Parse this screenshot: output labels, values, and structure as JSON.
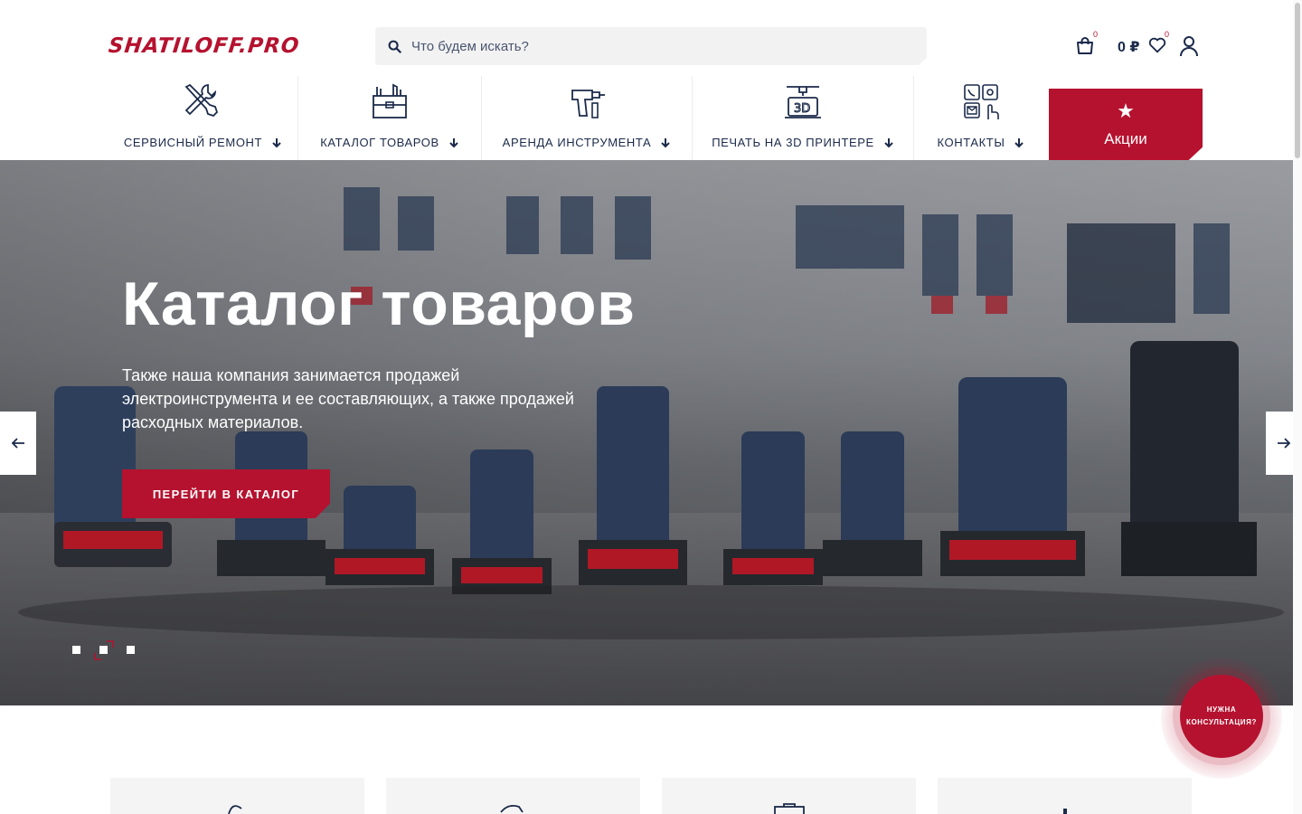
{
  "header": {
    "logo_text": "SHATILOFF.PRO",
    "search_placeholder": "Что будем искать?",
    "cart_count": "0",
    "cart_total": "0 ₽",
    "wishlist_count": "0"
  },
  "nav": {
    "items": [
      {
        "label": "СЕРВИСНЫЙ РЕМОНТ",
        "icon": "tools-repair-icon"
      },
      {
        "label": "КАТАЛОГ ТОВАРОВ",
        "icon": "toolbox-icon"
      },
      {
        "label": "АРЕНДА ИНСТРУМЕНТА",
        "icon": "drill-icon"
      },
      {
        "label": "ПЕЧАТЬ НА 3D ПРИНТЕРЕ",
        "icon": "3d-printer-icon"
      },
      {
        "label": "КОНТАКТЫ",
        "icon": "contacts-icon"
      }
    ],
    "promo_label": "Акции"
  },
  "hero": {
    "title": "Каталог товаров",
    "text": "Также наша компания занимается продажей электроинструмента и ее составляющих, а также продажей расходных материалов.",
    "button_label": "ПЕРЕЙТИ В КАТАЛОГ",
    "slides_total": 3,
    "active_slide": 2
  },
  "consult": {
    "label_line1": "НУЖНА",
    "label_line2": "КОНСУЛЬТАЦИЯ?"
  },
  "colors": {
    "brand": "#b5122f",
    "text": "#1b2a4a"
  }
}
